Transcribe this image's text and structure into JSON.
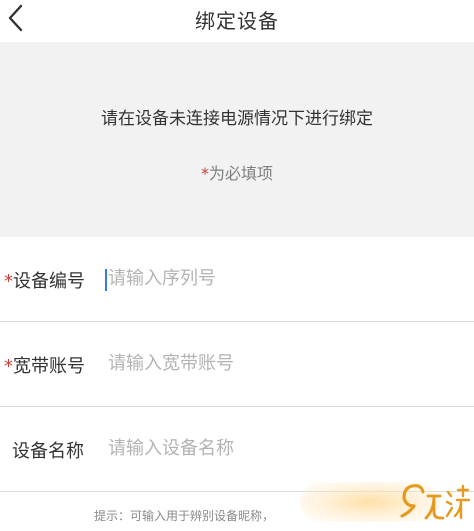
{
  "header": {
    "title": "绑定设备"
  },
  "notice": {
    "message": "请在设备未连接电源情况下进行绑定",
    "required_star": "*",
    "required_text": "为必填项"
  },
  "form": {
    "fields": [
      {
        "star": "*",
        "label": "设备编号",
        "placeholder": "请输入序列号",
        "value": ""
      },
      {
        "star": "*",
        "label": "宽带账号",
        "placeholder": "请输入宽带账号",
        "value": ""
      },
      {
        "star": "",
        "label": "设备名称",
        "placeholder": "请输入设备名称",
        "value": ""
      }
    ],
    "hint": "提示：可输入用于辨别设备昵称，"
  },
  "watermark": {
    "text": "九游"
  },
  "colors": {
    "required": "#c9413b",
    "caret": "#3a7bd5",
    "notice_bg": "#f2f2f2",
    "watermark": "#e59a1e"
  }
}
